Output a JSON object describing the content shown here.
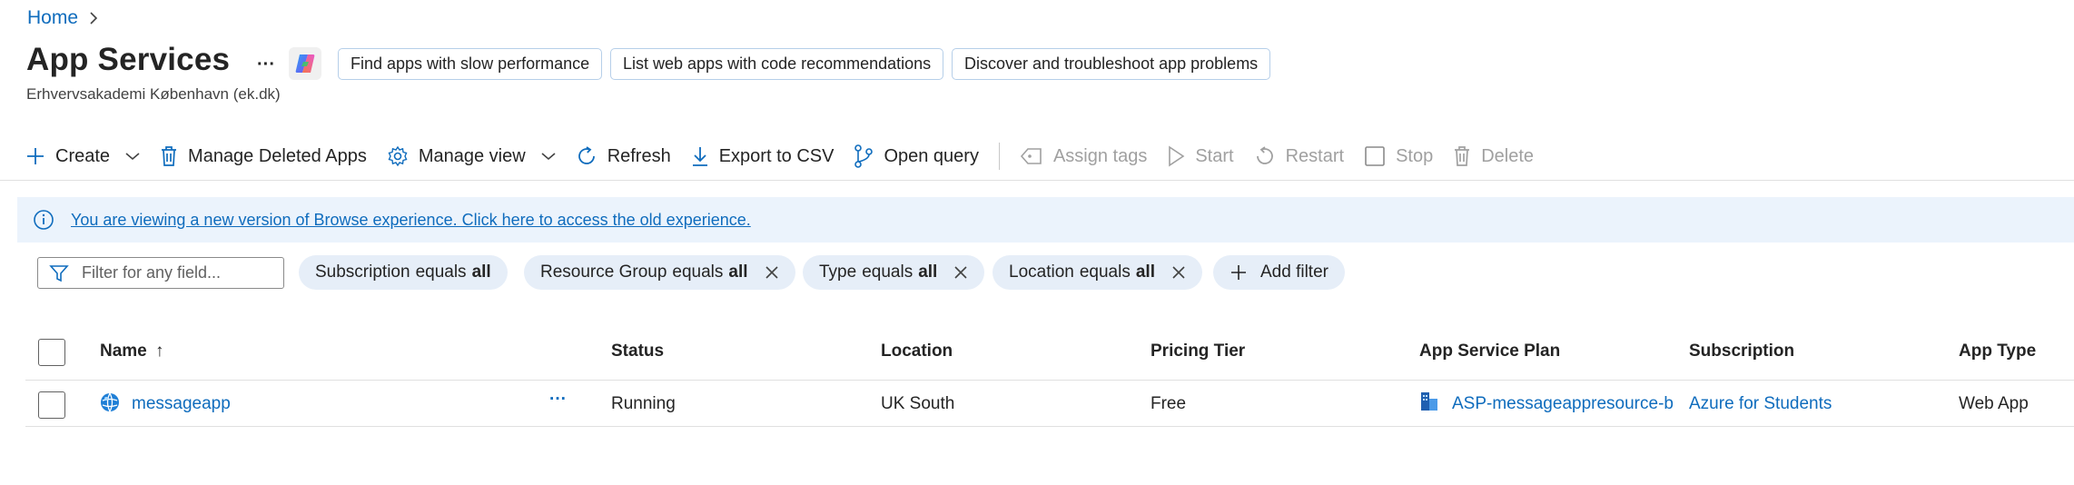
{
  "breadcrumb": {
    "home": "Home"
  },
  "header": {
    "title": "App Services",
    "subtitle": "Erhvervsakademi København (ek.dk)",
    "more_label": "···",
    "suggestions": [
      "Find apps with slow performance",
      "List web apps with code recommendations",
      "Discover and troubleshoot app problems"
    ]
  },
  "toolbar": {
    "create": "Create",
    "manage_deleted": "Manage Deleted Apps",
    "manage_view": "Manage view",
    "refresh": "Refresh",
    "export_csv": "Export to CSV",
    "open_query": "Open query",
    "assign_tags": "Assign tags",
    "start": "Start",
    "restart": "Restart",
    "stop": "Stop",
    "delete": "Delete"
  },
  "info": {
    "message": "You are viewing a new version of Browse experience. Click here to access the old experience."
  },
  "filters": {
    "placeholder": "Filter for any field...",
    "chips": [
      {
        "field": "Subscription",
        "op": "equals",
        "value": "all"
      },
      {
        "field": "Resource Group",
        "op": "equals",
        "value": "all"
      },
      {
        "field": "Type",
        "op": "equals",
        "value": "all"
      },
      {
        "field": "Location",
        "op": "equals",
        "value": "all"
      }
    ],
    "add_filter": "Add filter"
  },
  "table": {
    "columns": {
      "name": "Name",
      "sort_arrow": "↑",
      "status": "Status",
      "location": "Location",
      "pricing_tier": "Pricing Tier",
      "app_service_plan": "App Service Plan",
      "subscription": "Subscription",
      "app_type": "App Type"
    },
    "rows": [
      {
        "name": "messageapp",
        "more": "···",
        "status": "Running",
        "location": "UK South",
        "pricing_tier": "Free",
        "app_service_plan": "ASP-messageappresource-b",
        "subscription": "Azure for Students",
        "app_type": "Web App"
      }
    ]
  },
  "colors": {
    "accent": "#0f6cbd",
    "info_bg": "#ebf3fc",
    "chip_bg": "#e6eef8"
  }
}
